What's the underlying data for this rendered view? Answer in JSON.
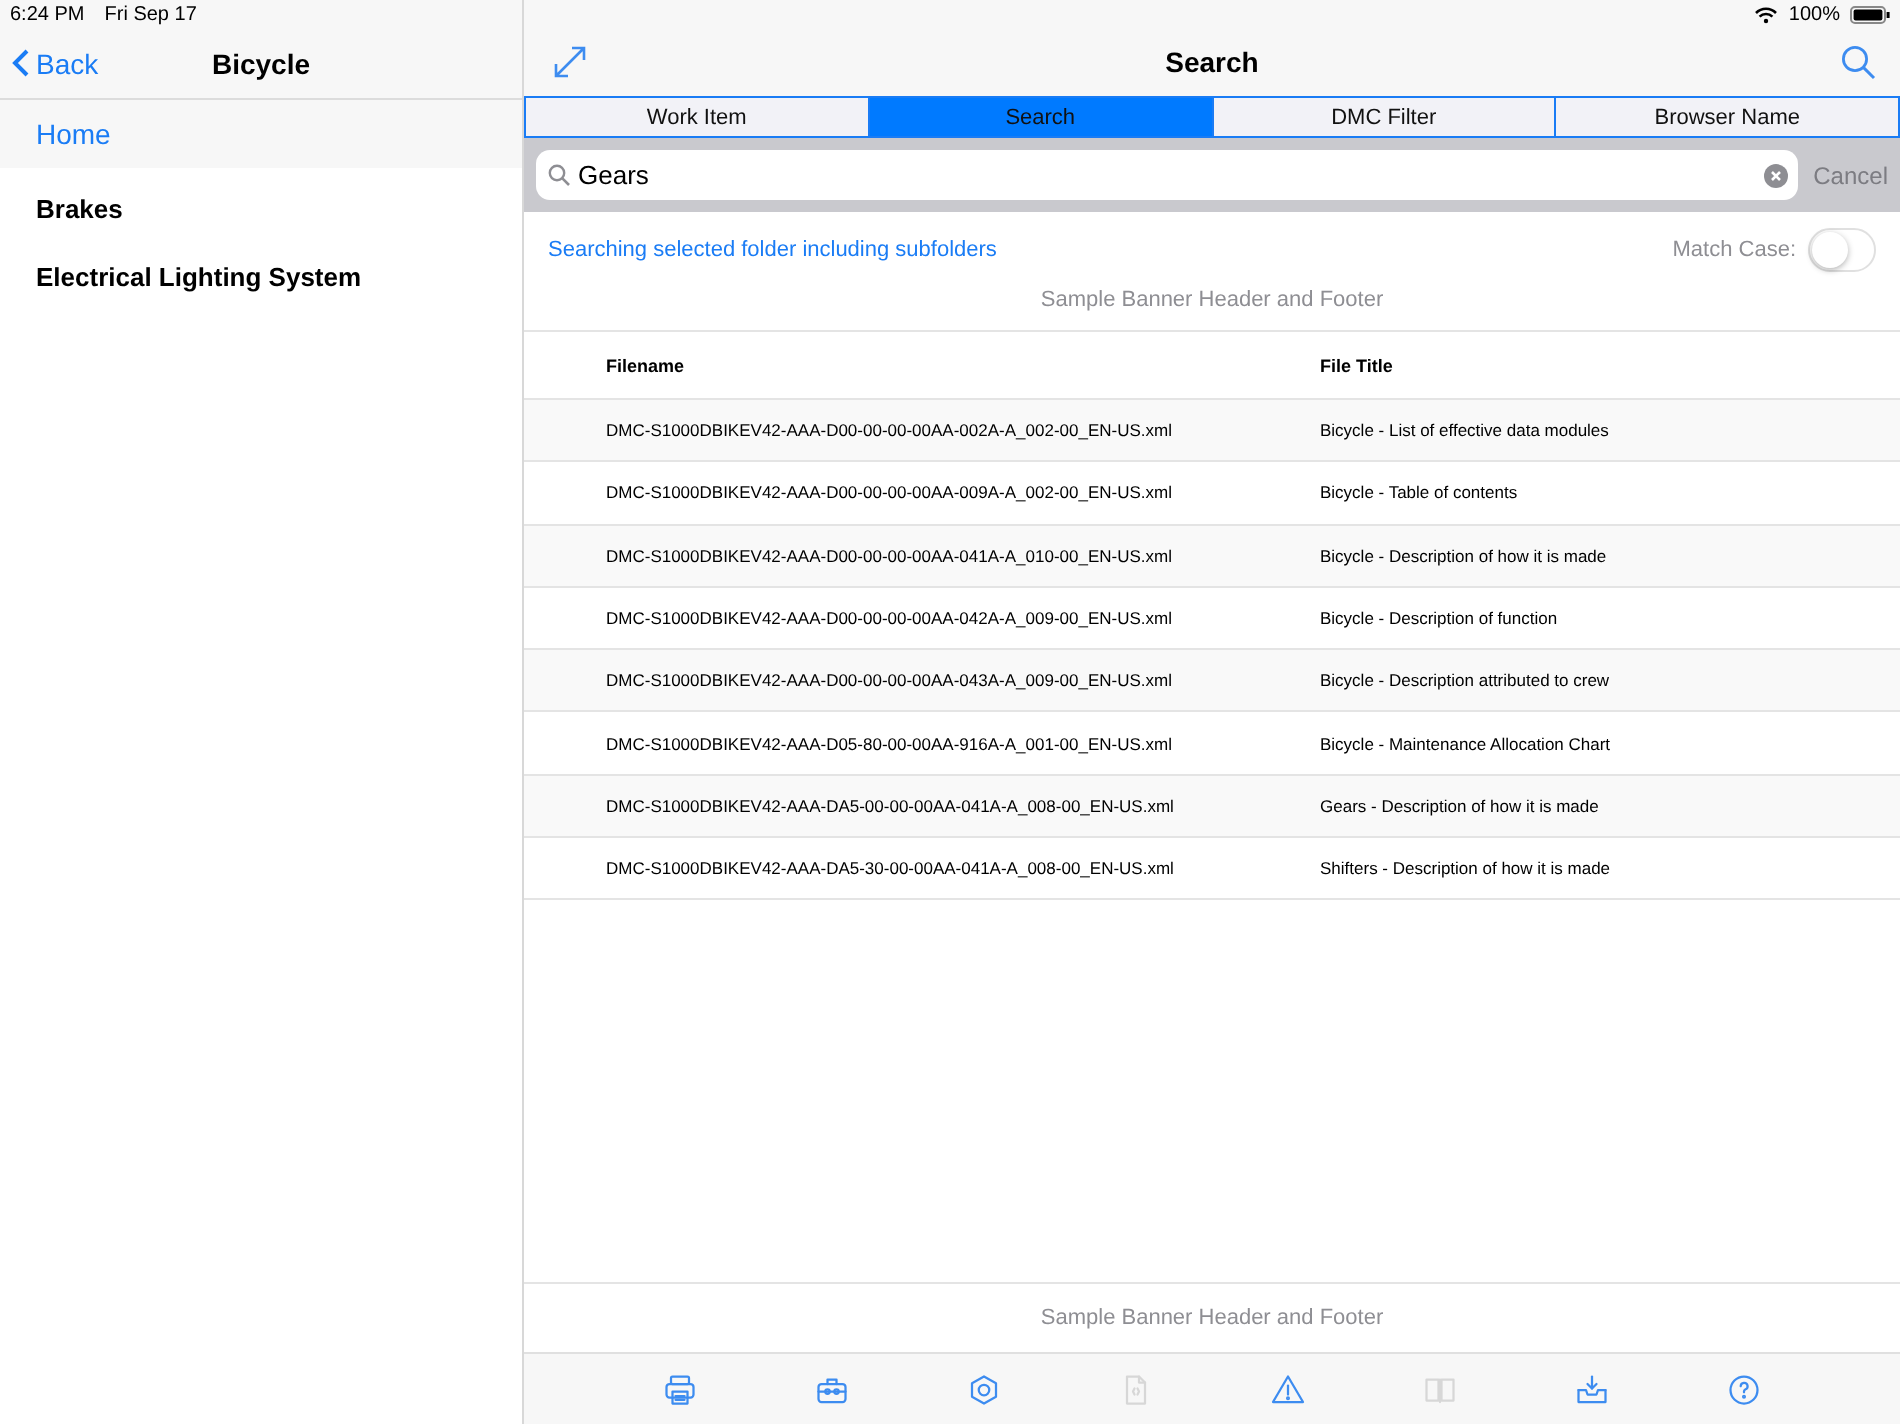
{
  "status_bar": {
    "time": "6:24 PM",
    "date": "Fri Sep 17",
    "battery": "100%"
  },
  "sidebar": {
    "back": "Back",
    "title": "Bicycle",
    "home": "Home",
    "items": [
      {
        "label": "Brakes"
      },
      {
        "label": "Electrical Lighting System"
      }
    ]
  },
  "main": {
    "title": "Search",
    "tabs": [
      {
        "label": "Work Item",
        "selected": false
      },
      {
        "label": "Search",
        "selected": true
      },
      {
        "label": "DMC Filter",
        "selected": false
      },
      {
        "label": "Browser Name",
        "selected": false
      }
    ],
    "search": {
      "value": "Gears",
      "cancel": "Cancel"
    },
    "scope": "Searching selected folder including subfolders",
    "match_case": {
      "label": "Match Case:",
      "on": false
    },
    "banner_header": "Sample Banner Header and Footer",
    "table": {
      "columns": [
        "Filename",
        "File Title"
      ],
      "rows": [
        [
          "DMC-S1000DBIKEV42-AAA-D00-00-00-00AA-002A-A_002-00_EN-US.xml",
          "Bicycle - List of effective data modules"
        ],
        [
          "DMC-S1000DBIKEV42-AAA-D00-00-00-00AA-009A-A_002-00_EN-US.xml",
          "Bicycle - Table of contents"
        ],
        [
          "DMC-S1000DBIKEV42-AAA-D00-00-00-00AA-041A-A_010-00_EN-US.xml",
          "Bicycle - Description of how it is made"
        ],
        [
          "DMC-S1000DBIKEV42-AAA-D00-00-00-00AA-042A-A_009-00_EN-US.xml",
          "Bicycle - Description of function"
        ],
        [
          "DMC-S1000DBIKEV42-AAA-D00-00-00-00AA-043A-A_009-00_EN-US.xml",
          "Bicycle - Description attributed to crew"
        ],
        [
          "DMC-S1000DBIKEV42-AAA-D05-80-00-00AA-916A-A_001-00_EN-US.xml",
          "Bicycle - Maintenance Allocation Chart"
        ],
        [
          "DMC-S1000DBIKEV42-AAA-DA5-00-00-00AA-041A-A_008-00_EN-US.xml",
          "Gears - Description of how it is made"
        ],
        [
          "DMC-S1000DBIKEV42-AAA-DA5-30-00-00AA-041A-A_008-00_EN-US.xml",
          "Shifters - Description of how it is made"
        ]
      ]
    },
    "banner_footer": "Sample Banner Header and Footer",
    "toolbar": [
      {
        "kind": "printer",
        "disabled": false
      },
      {
        "kind": "toolbox",
        "disabled": false
      },
      {
        "kind": "hexagon",
        "disabled": false
      },
      {
        "kind": "document",
        "disabled": true
      },
      {
        "kind": "warning",
        "disabled": false
      },
      {
        "kind": "book",
        "disabled": true
      },
      {
        "kind": "inbox",
        "disabled": false
      },
      {
        "kind": "help",
        "disabled": false
      }
    ]
  }
}
